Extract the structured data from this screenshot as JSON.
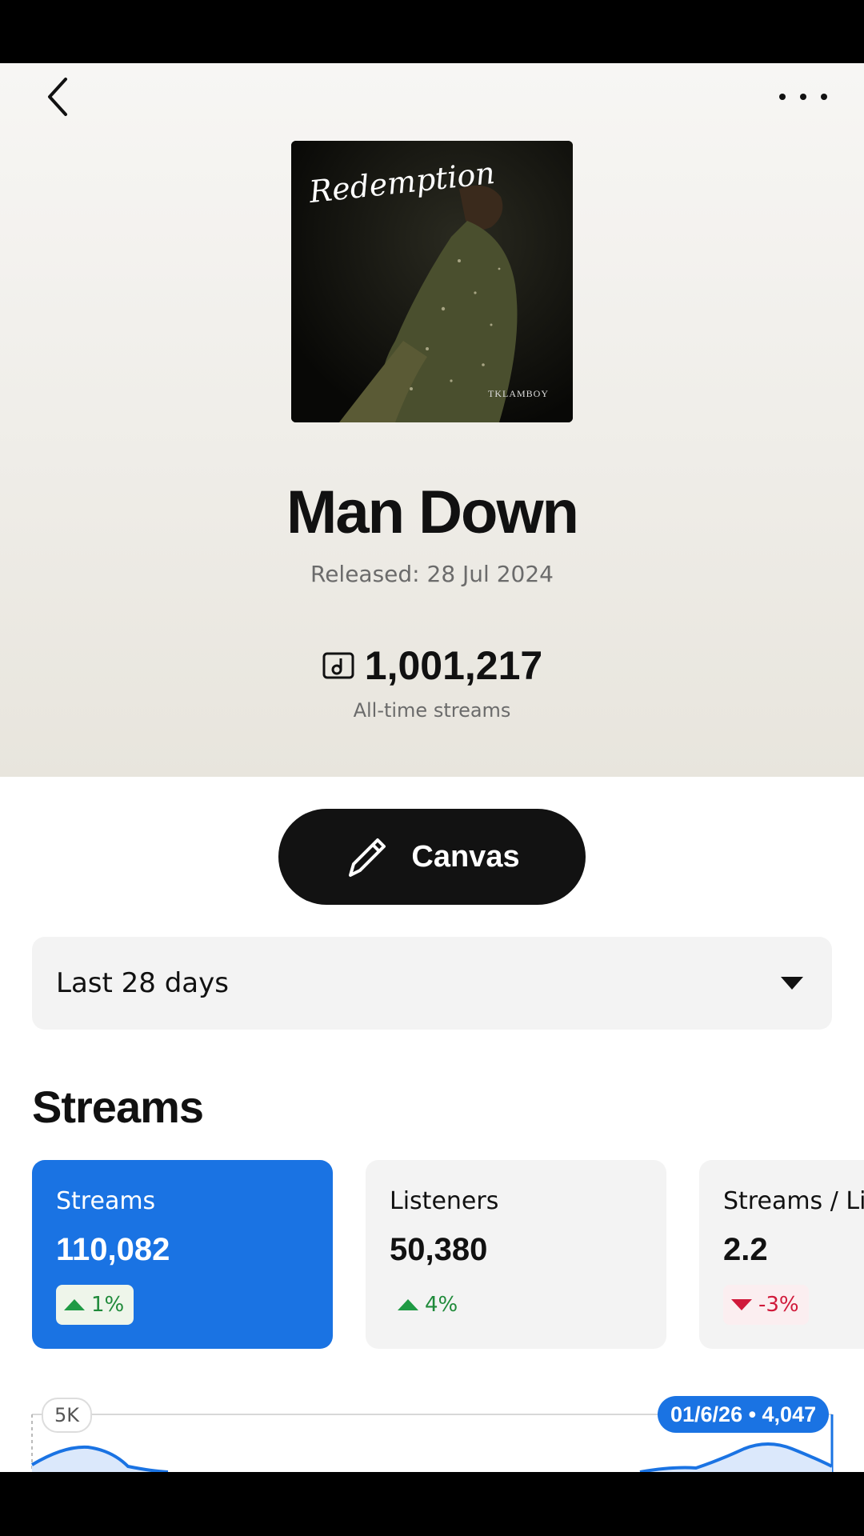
{
  "header": {
    "back_icon": "chevron-left-icon",
    "more_icon": "more-horizontal-icon"
  },
  "cover": {
    "title_text": "Redemption",
    "artist_text": "TKLAMBOY"
  },
  "song": {
    "title": "Man Down",
    "released": "Released: 28 Jul 2024",
    "alltime_streams": "1,001,217",
    "alltime_label": "All-time streams"
  },
  "canvas_button": {
    "label": "Canvas",
    "icon": "pencil-icon"
  },
  "date_range": {
    "selected": "Last 28 days"
  },
  "section": {
    "title": "Streams"
  },
  "cards": [
    {
      "label": "Streams",
      "value": "110,082",
      "change": "1%",
      "trend": "up"
    },
    {
      "label": "Listeners",
      "value": "50,380",
      "change": "4%",
      "trend": "up"
    },
    {
      "label": "Streams / Listener",
      "value": "2.2",
      "change": "-3%",
      "trend": "down"
    }
  ],
  "chart": {
    "y_label": "5K",
    "tooltip": "01/6/26 • 4,047"
  },
  "colors": {
    "accent": "#1a73e3",
    "positive": "#1f9a44",
    "negative": "#d0193a",
    "button": "#121212"
  }
}
